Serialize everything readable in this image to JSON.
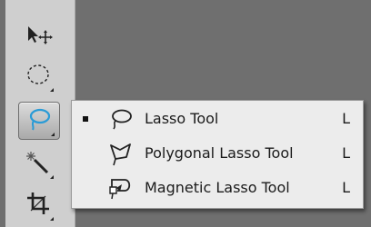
{
  "toolbar": {
    "tools": [
      {
        "name": "move-tool",
        "icon": "move-arrow-icon"
      },
      {
        "name": "marquee-tool",
        "icon": "elliptical-marquee-icon"
      },
      {
        "name": "lasso-tool",
        "icon": "lasso-icon",
        "active": true
      },
      {
        "name": "magic-wand-tool",
        "icon": "magic-wand-icon"
      },
      {
        "name": "crop-tool",
        "icon": "crop-icon"
      }
    ]
  },
  "flyout": {
    "items": [
      {
        "label": "Lasso Tool",
        "shortcut": "L",
        "icon": "lasso-icon",
        "selected": true
      },
      {
        "label": "Polygonal Lasso Tool",
        "shortcut": "L",
        "icon": "polygonal-lasso-icon",
        "selected": false
      },
      {
        "label": "Magnetic Lasso Tool",
        "shortcut": "L",
        "icon": "magnetic-lasso-icon",
        "selected": false
      }
    ]
  },
  "colors": {
    "canvas": "#6f6f6f",
    "toolbar": "#cfcfcf",
    "menu": "#ececec",
    "lasso_accent": "#2a9bd6"
  }
}
